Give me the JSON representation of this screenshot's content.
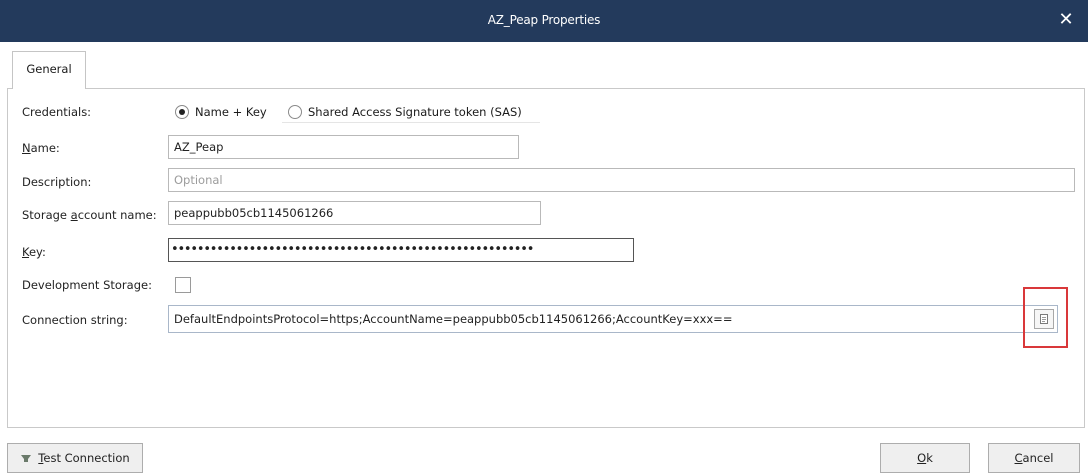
{
  "window": {
    "title": "AZ_Peap Properties",
    "close_glyph": "✕"
  },
  "tabs": [
    {
      "label": "General",
      "selected": true
    }
  ],
  "form": {
    "credentials": {
      "label": "Credentials:",
      "options": [
        {
          "label": "Name + Key",
          "selected": true
        },
        {
          "label": "Shared Access Signature token (SAS)",
          "selected": false
        }
      ]
    },
    "name": {
      "label_first": "N",
      "label_rest": "ame:",
      "value": "AZ_Peap"
    },
    "description": {
      "label": "Description:",
      "value": "",
      "placeholder": "Optional"
    },
    "storage_account": {
      "label_pre": "Storage ",
      "label_ul": "a",
      "label_post": "ccount name:",
      "value": "peappubb05cb1145061266"
    },
    "key": {
      "label_first": "K",
      "label_rest": "ey:",
      "masked_value": "••••••••••••••••••••••••••••••••••••••••••••••••••••••••"
    },
    "development_storage": {
      "label": "Development Storage:",
      "checked": false
    },
    "connection_string": {
      "label": "Connection string:",
      "value": "DefaultEndpointsProtocol=https;AccountName=peappubb05cb1145061266;AccountKey=xxx==",
      "copy_icon": "copy-clipboard-icon"
    }
  },
  "footer": {
    "test_connection": {
      "label_first": "T",
      "label_rest": "est Connection",
      "icon": "plug-icon"
    },
    "ok": {
      "label_first": "O",
      "label_rest": "k"
    },
    "cancel": {
      "label_first": "C",
      "label_rest": "ancel"
    }
  },
  "colors": {
    "titlebar": "#233a5c",
    "highlight": "#d9383a"
  }
}
